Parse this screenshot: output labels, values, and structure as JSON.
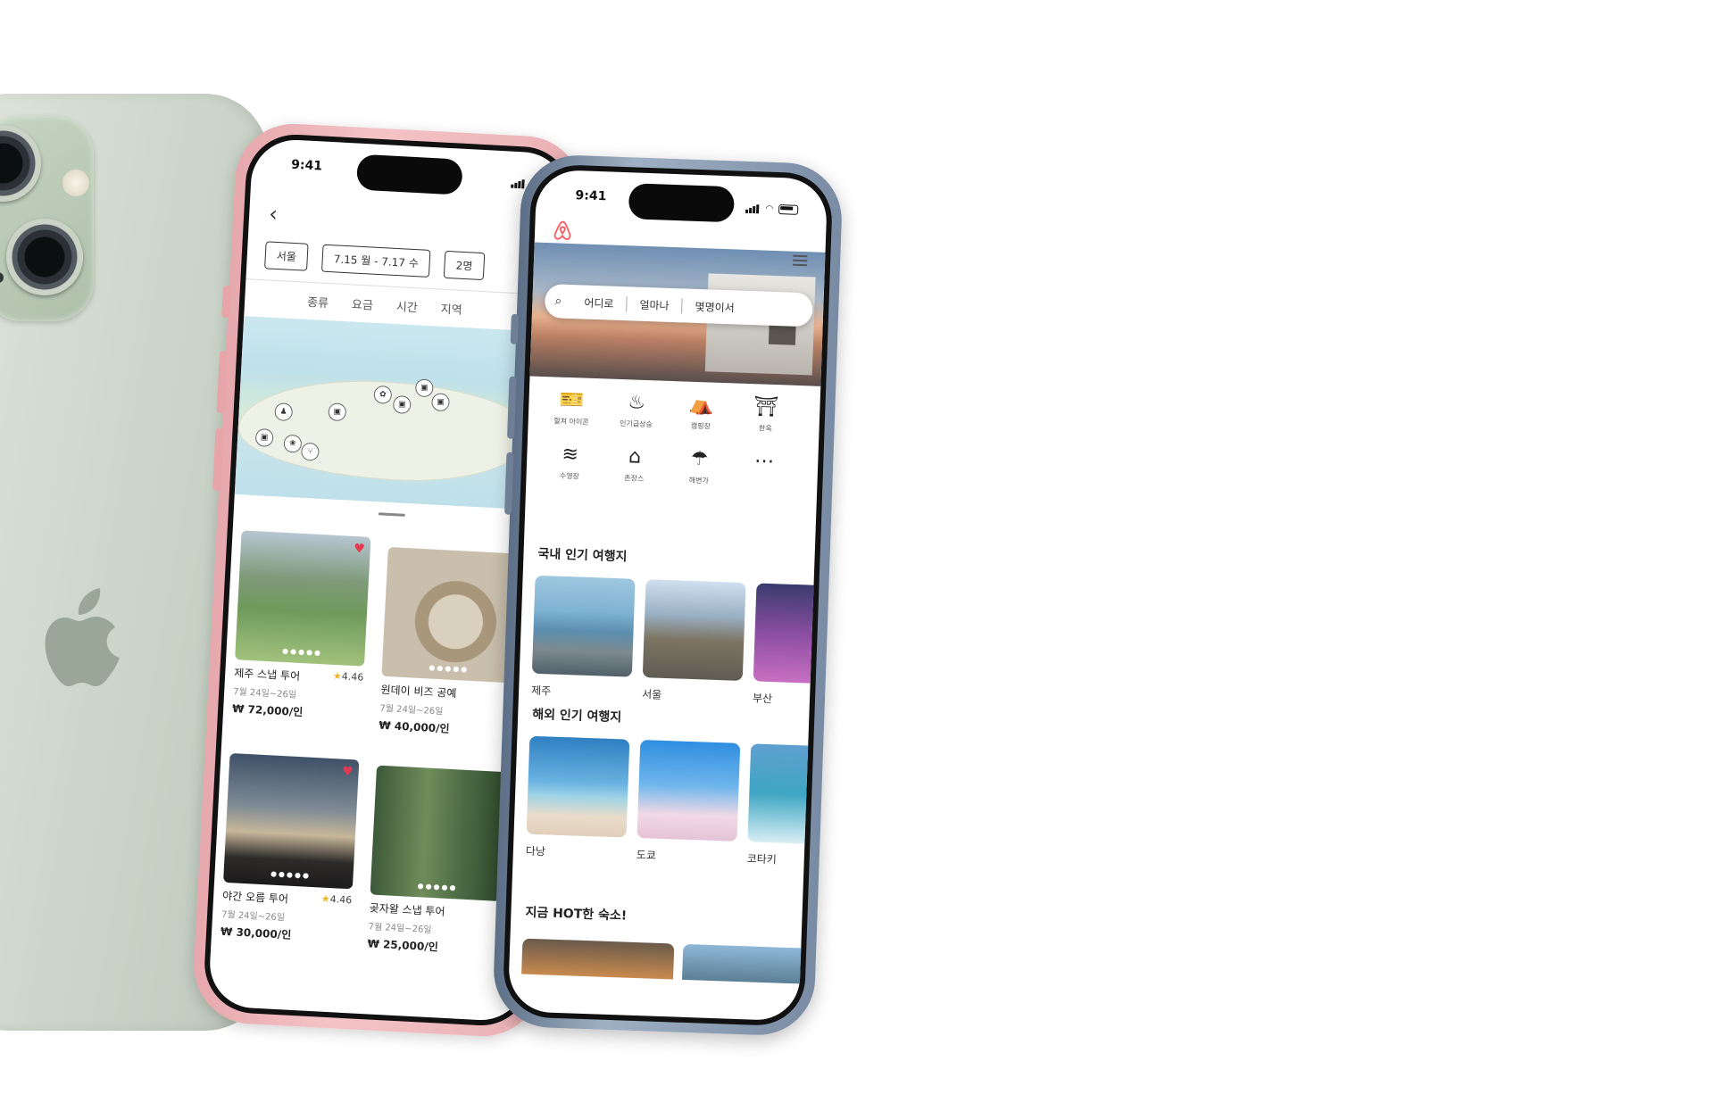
{
  "pink_screen": {
    "status_time": "9:41",
    "filters": [
      "서울",
      "7.15 월 - 7.17 수",
      "2명"
    ],
    "sort_tabs": [
      "종류",
      "요금",
      "시간",
      "지역"
    ],
    "cards": [
      {
        "title": "제주 스냅 투어",
        "rating": "4.46",
        "date": "7월 24일~26일",
        "price": "₩ 72,000/인",
        "liked": true
      },
      {
        "title": "원데이 비즈 공예",
        "rating": "",
        "date": "7월 24일~26일",
        "price": "₩ 40,000/인",
        "liked": false
      },
      {
        "title": "야간 오름 투어",
        "rating": "4.46",
        "date": "7월 24일~26일",
        "price": "₩ 30,000/인",
        "liked": true
      },
      {
        "title": "곶자왈 스냅 투어",
        "rating": "",
        "date": "7월 24일~26일",
        "price": "₩ 25,000/인",
        "liked": false
      }
    ]
  },
  "blue_screen": {
    "status_time": "9:41",
    "search": {
      "where": "어디로",
      "how_much": "얼마나",
      "how_many": "몇명이서"
    },
    "categories": [
      {
        "label": "할쳐 아이콘",
        "icon": "ticket-icon"
      },
      {
        "label": "인기급상승",
        "icon": "flame-icon"
      },
      {
        "label": "캠핑장",
        "icon": "camping-icon"
      },
      {
        "label": "한옥",
        "icon": "hanok-icon"
      },
      {
        "label": "수영장",
        "icon": "pool-icon"
      },
      {
        "label": "촌장스",
        "icon": "countryside-icon"
      },
      {
        "label": "해변가",
        "icon": "beach-umbrella-icon"
      },
      {
        "label": "",
        "icon": "more-icon"
      }
    ],
    "domestic_title": "국내 인기 여행지",
    "domestic": [
      "제주",
      "서울",
      "부산"
    ],
    "overseas_title": "해외 인기 여행지",
    "overseas": [
      "다낭",
      "도쿄",
      "코타키"
    ],
    "hot_title": "지금 HOT한 숙소!"
  },
  "colors": {
    "brand": "#FF5A5F",
    "heart": "#E33950",
    "star": "#F3B323"
  }
}
